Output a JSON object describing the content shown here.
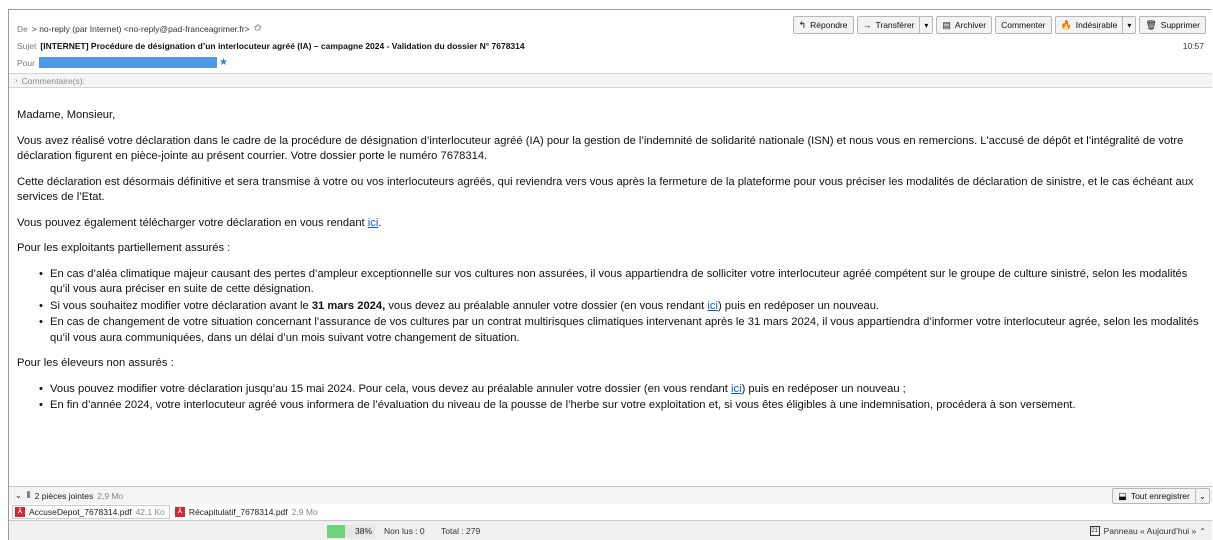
{
  "header": {
    "from_label": "De",
    "from_value": "> no-reply (par Internet) <no-reply@pad-franceagrimer.fr>",
    "star": "✩",
    "subject_label": "Sujet",
    "subject_value": "[INTERNET] Procédure de désignation d’un interlocuteur agréé (IA) – campagne 2024 - Validation du dossier N° 7678314",
    "time": "10:57",
    "to_label": "Pour"
  },
  "toolbar": {
    "reply": "Répondre",
    "forward": "Transférer",
    "archive": "Archiver",
    "comment": "Commenter",
    "junk": "Indésirable",
    "delete": "Supprimer"
  },
  "comment_bar": {
    "label": "Commentaire(s):"
  },
  "body": {
    "greeting": "Madame, Monsieur,",
    "p1": "Vous avez réalisé votre déclaration dans le cadre de la procédure de désignation d’interlocuteur agréé (IA) pour la gestion de l’indemnité de solidarité nationale (ISN) et nous vous en remercions. L'accusé de dépôt et l’intégralité de votre déclaration figurent en pièce-jointe au présent courrier. Votre dossier porte le numéro 7678314.",
    "p2": "Cette déclaration est désormais définitive et sera transmise à votre ou vos interlocuteurs agréés, qui reviendra vers vous après la fermeture de la plateforme pour vous préciser les modalités de déclaration de sinistre, et le cas échéant aux services de l’Etat.",
    "p3_pre": "Vous pouvez également télécharger votre déclaration en vous rendant ",
    "link_text": "ici",
    "p3_post": ".",
    "section1": "Pour les exploitants partiellement assurés :",
    "s1_b1": "En cas d’aléa climatique majeur causant des pertes d’ampleur exceptionnelle sur vos cultures non assurées, il vous appartiendra de solliciter votre interlocuteur agréé compétent sur le groupe de culture sinistré, selon les modalités qu’il vous aura préciser en suite de cette désignation.",
    "s1_b2_pre": "Si vous souhaitez modifier votre déclaration avant le ",
    "s1_b2_bold": "31 mars 2024,",
    "s1_b2_mid": " vous devez au préalable annuler votre dossier (en vous rendant ",
    "s1_b2_post": ") puis en redéposer un nouveau.",
    "s1_b3": "En cas de changement de votre situation concernant l’assurance de vos cultures par un contrat multirisques climatiques intervenant après le 31 mars 2024, il vous appartiendra d’informer votre interlocuteur agrée, selon les modalités qu’il vous aura communiquées, dans un délai d’un mois suivant votre changement de situation.",
    "section2": "Pour les éleveurs non assurés :",
    "s2_b1_pre": "Vous pouvez modifier votre déclaration jusqu’au 15 mai 2024. Pour cela, vous devez au préalable annuler votre dossier (en vous rendant ",
    "s2_b1_post": ") puis en redéposer un nouveau ;",
    "s2_b2": "En fin d’année 2024, votre interlocuteur agréé vous informera de l’évaluation du niveau de la pousse de l’herbe sur votre exploitation et, si vous êtes éligibles à une indemnisation, procédera à son versement."
  },
  "attachments": {
    "summary": "2 pièces jointes",
    "total_size": "2,9 Mo",
    "save_all": "Tout enregistrer",
    "files": [
      {
        "name": "AccuseDepot_7678314.pdf",
        "size": "42,1 Ko"
      },
      {
        "name": "Récapitulatif_7678314.pdf",
        "size": "2,9 Mo"
      }
    ]
  },
  "status": {
    "progress_label": "38%",
    "progress_value": 0.38,
    "unread": "Non lus : 0",
    "total": "Total : 279",
    "panel": "Panneau « Aujourd’hui »",
    "calendar_day": "21"
  },
  "colors": {
    "redaction": "#4f98e6",
    "link": "#0b5bd7",
    "progress": "#6fd27a",
    "pdf": "#d8262e"
  }
}
